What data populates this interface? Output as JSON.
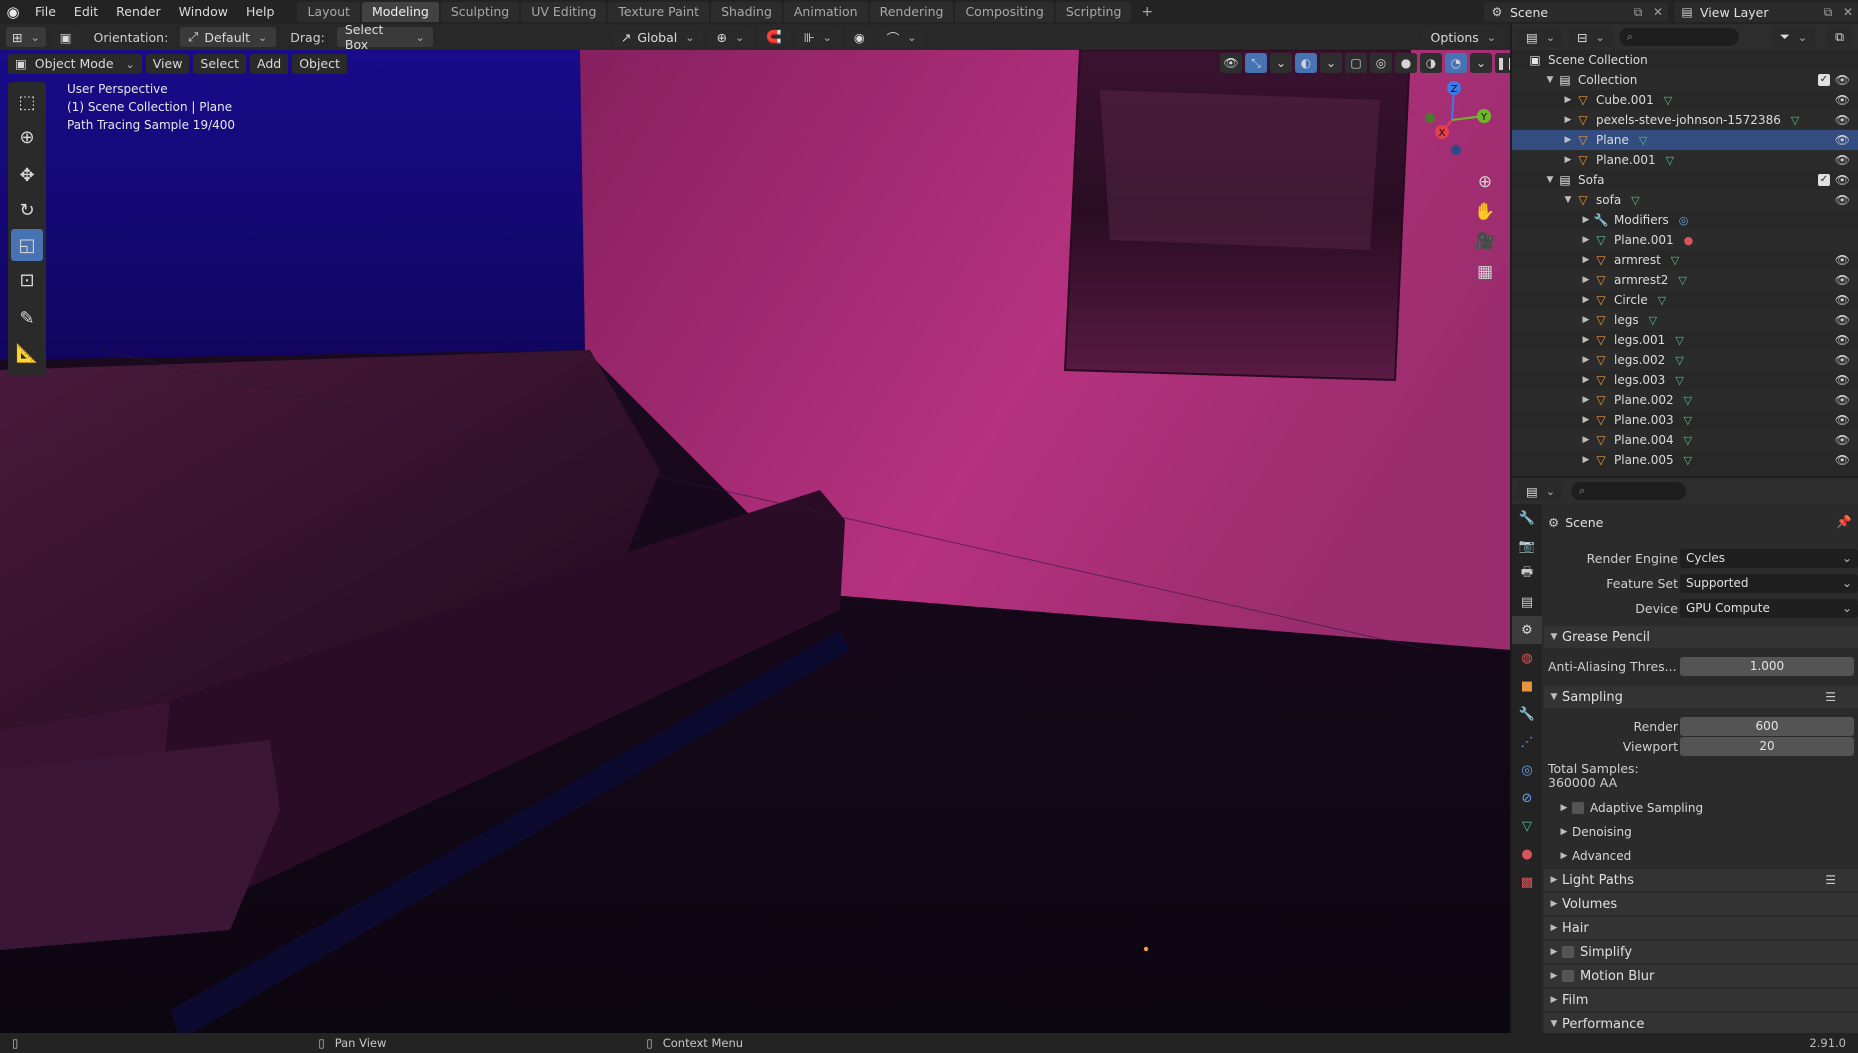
{
  "app_logo": "blender-logo-icon",
  "menu": [
    "File",
    "Edit",
    "Render",
    "Window",
    "Help"
  ],
  "workspace_tabs": [
    "Layout",
    "Modeling",
    "Sculpting",
    "UV Editing",
    "Texture Paint",
    "Shading",
    "Animation",
    "Rendering",
    "Compositing",
    "Scripting"
  ],
  "active_workspace": "Modeling",
  "workspace_add": "+",
  "scene_name": "Scene",
  "view_layer": "View Layer",
  "header": {
    "orientation_label": "Orientation:",
    "orientation_value": "Default",
    "drag_label": "Drag:",
    "drag_value": "Select Box",
    "transform_space": "Global",
    "options_label": "Options"
  },
  "viewport": {
    "mode": "Object Mode",
    "menus": [
      "View",
      "Select",
      "Add",
      "Object"
    ],
    "info_line1": "User Perspective",
    "info_line2": "(1) Scene Collection | Plane",
    "info_line3": "Path Tracing Sample 19/400",
    "axis_x": "X",
    "axis_y": "Y",
    "axis_z": "Z",
    "shading_mode": "rendered",
    "active_tool": "scale"
  },
  "outliner": {
    "root": "Scene Collection",
    "rows": [
      {
        "name": "Collection",
        "type": "collection",
        "depth": 1,
        "expanded": true,
        "checked": true
      },
      {
        "name": "Cube.001",
        "type": "mesh",
        "depth": 2
      },
      {
        "name": "pexels-steve-johnson-1572386",
        "type": "mesh",
        "depth": 2
      },
      {
        "name": "Plane",
        "type": "mesh",
        "depth": 2,
        "active": true
      },
      {
        "name": "Plane.001",
        "type": "mesh",
        "depth": 2
      },
      {
        "name": "Sofa",
        "type": "collection",
        "depth": 1,
        "expanded": true,
        "checked": true
      },
      {
        "name": "sofa",
        "type": "mesh",
        "depth": 2,
        "expanded": true
      },
      {
        "name": "Modifiers",
        "type": "modifiers",
        "depth": 3
      },
      {
        "name": "Plane.001",
        "type": "mesh-data",
        "depth": 3
      },
      {
        "name": "armrest",
        "type": "mesh",
        "depth": 3
      },
      {
        "name": "armrest2",
        "type": "mesh",
        "depth": 3
      },
      {
        "name": "Circle",
        "type": "mesh",
        "depth": 3
      },
      {
        "name": "legs",
        "type": "mesh",
        "depth": 3
      },
      {
        "name": "legs.001",
        "type": "mesh",
        "depth": 3
      },
      {
        "name": "legs.002",
        "type": "mesh",
        "depth": 3
      },
      {
        "name": "legs.003",
        "type": "mesh",
        "depth": 3
      },
      {
        "name": "Plane.002",
        "type": "mesh",
        "depth": 3
      },
      {
        "name": "Plane.003",
        "type": "mesh",
        "depth": 3
      },
      {
        "name": "Plane.004",
        "type": "mesh",
        "depth": 3
      },
      {
        "name": "Plane.005",
        "type": "mesh",
        "depth": 3
      }
    ]
  },
  "properties": {
    "context": "Scene",
    "render_engine_label": "Render Engine",
    "render_engine": "Cycles",
    "feature_set_label": "Feature Set",
    "feature_set": "Supported",
    "device_label": "Device",
    "device": "GPU Compute",
    "grease_pencil": "Grease Pencil",
    "aa_threshold_label": "Anti-Aliasing Thres...",
    "aa_threshold": "1.000",
    "sampling": "Sampling",
    "render_samples_label": "Render",
    "render_samples": "600",
    "viewport_samples_label": "Viewport",
    "viewport_samples": "20",
    "total_samples_label": "Total Samples:",
    "total_samples_value": "360000 AA",
    "adaptive_sampling": "Adaptive Sampling",
    "denoising": "Denoising",
    "advanced": "Advanced",
    "light_paths": "Light Paths",
    "volumes": "Volumes",
    "hair": "Hair",
    "simplify": "Simplify",
    "motion_blur": "Motion Blur",
    "film": "Film",
    "performance": "Performance"
  },
  "status": {
    "pan_view": "Pan View",
    "context_menu": "Context Menu",
    "version": "2.91.0"
  },
  "colors": {
    "accent": "#4772b3",
    "wall": "#b0307a",
    "collection": "#e6e6e6",
    "mesh": "#e7953e",
    "data": "#56c08a"
  }
}
